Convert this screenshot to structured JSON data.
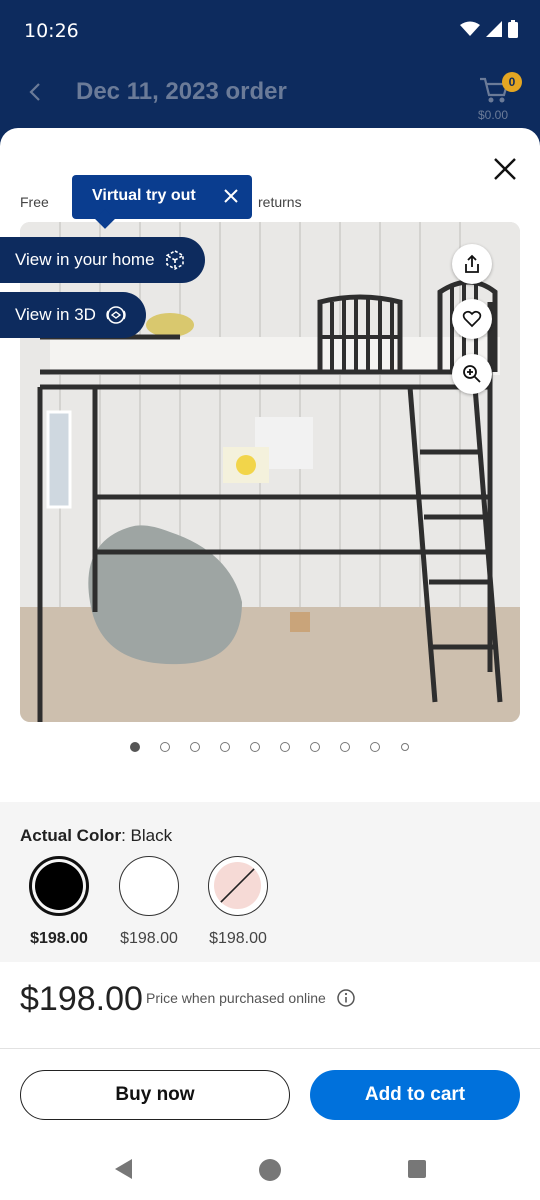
{
  "status": {
    "time": "10:26"
  },
  "header": {
    "title": "Dec 11, 2023 order",
    "cart_count": "0",
    "cart_total": "$0.00"
  },
  "sheet": {
    "behind_text_left": "Free",
    "behind_text_right": "returns",
    "tooltip": "Virtual try out",
    "view_home": "View in your home",
    "view_3d": "View in 3D",
    "carousel": {
      "total": 10,
      "active_index": 0
    }
  },
  "color": {
    "label": "Actual Color",
    "value": ": Black",
    "options": [
      {
        "name": "Black",
        "price": "$198.00",
        "selected": true,
        "fill": "#000000"
      },
      {
        "name": "White",
        "price": "$198.00",
        "selected": false,
        "fill": "#ffffff"
      },
      {
        "name": "Pink",
        "price": "$198.00",
        "selected": false,
        "fill": "#f6dad6",
        "unavailable": true
      }
    ]
  },
  "price": {
    "amount": "$198.00",
    "note": "Price when purchased online"
  },
  "actions": {
    "buy_now": "Buy now",
    "add_to_cart": "Add to cart"
  },
  "colors": {
    "brand_navy": "#0d2b5e",
    "primary_blue": "#0071dc",
    "badge_yellow": "#e4a622"
  }
}
